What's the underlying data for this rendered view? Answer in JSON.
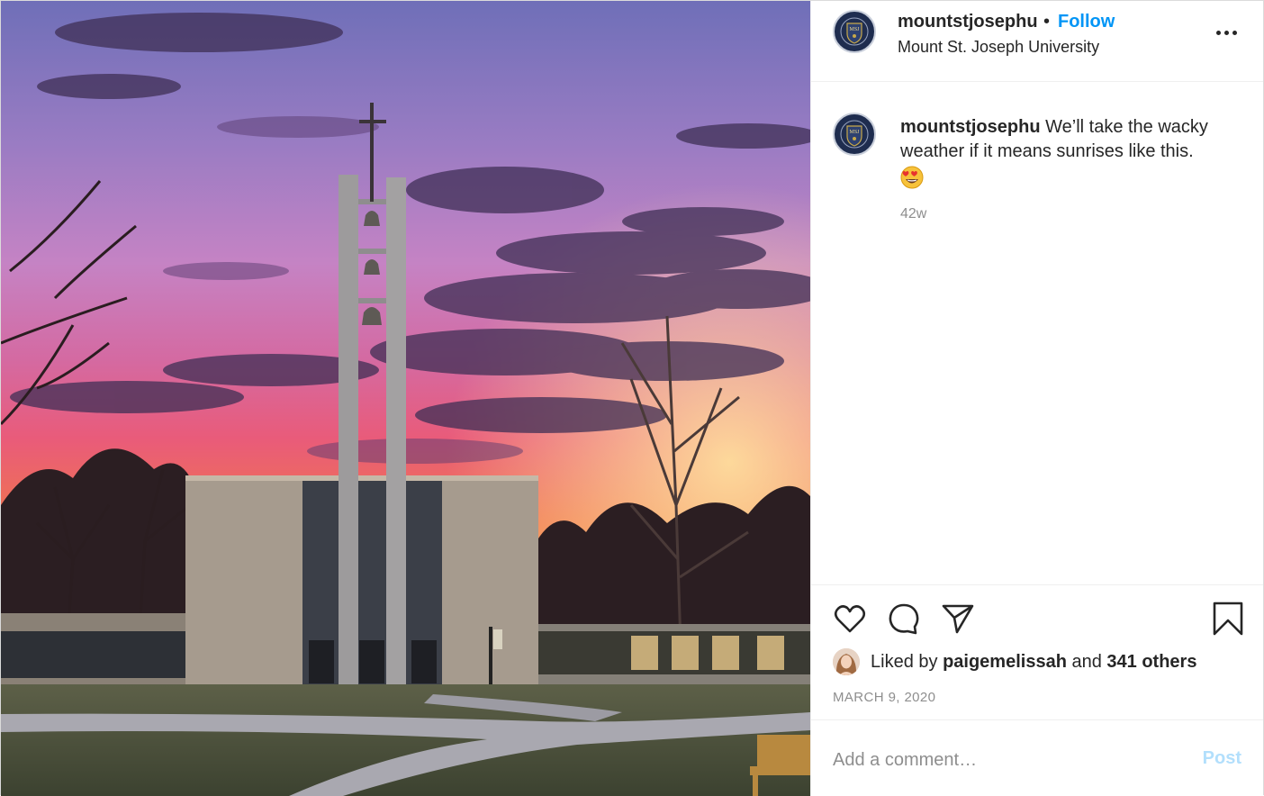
{
  "post": {
    "username": "mountstjosephu",
    "dot": "•",
    "follow_label": "Follow",
    "location": "Mount St. Joseph University",
    "avatar_icon": "university-seal-icon",
    "more_icon": "more-horizontal-icon",
    "avatar_monogram": "MSJ"
  },
  "caption": {
    "username": "mountstjosephu",
    "text": "We’ll take the wacky weather if it means sunrises like this.",
    "emoji": "smiling-face-with-heart-eyes-icon",
    "age": "42w"
  },
  "actions": {
    "like_icon": "heart-icon",
    "comment_icon": "comment-icon",
    "share_icon": "share-icon",
    "save_icon": "bookmark-icon"
  },
  "likes": {
    "prefix": "Liked by",
    "user": "paigemelissah",
    "joiner": "and",
    "others": "341 others"
  },
  "date": "MARCH 9, 2020",
  "comment": {
    "placeholder": "Add a comment…",
    "post_label": "Post"
  },
  "colors": {
    "link_blue": "#0095f6",
    "post_disabled": "#b2dffc",
    "meta_gray": "#8e8e8e"
  }
}
